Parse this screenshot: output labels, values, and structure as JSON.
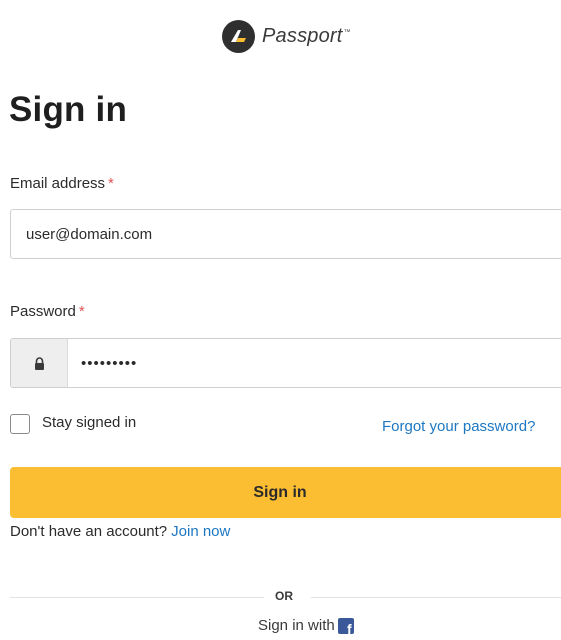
{
  "brand": {
    "name": "Passport",
    "trademark": "™",
    "logo_icon": "passport-logo-icon"
  },
  "form": {
    "title": "Sign in",
    "email": {
      "label": "Email address",
      "required_mark": "*",
      "value": "user@domain.com"
    },
    "password": {
      "label": "Password",
      "required_mark": "*",
      "value": "password1",
      "icon": "lock-icon"
    },
    "stay_signed_in": {
      "label": "Stay signed in",
      "checked": false
    },
    "forgot_password": "Forgot your password?",
    "submit_label": "Sign in",
    "no_account_text": "Don't have an account?",
    "join_label": "Join now",
    "divider_text": "OR",
    "social_signin_text": "Sign in with",
    "social_icon": "facebook-icon"
  },
  "colors": {
    "accent": "#fbbd31",
    "link": "#1d77c2",
    "required": "#e05353",
    "facebook": "#3b5998"
  }
}
